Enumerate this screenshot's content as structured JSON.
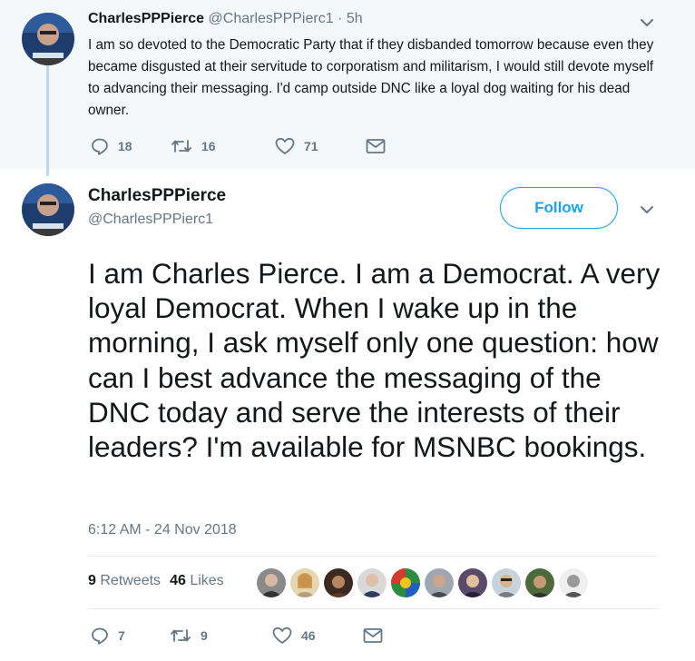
{
  "parent_tweet": {
    "name": "CharlesPPPierce",
    "handle": "@CharlesPPPierc1",
    "separator": "·",
    "time": "5h",
    "text": "I am so devoted to the Democratic Party that if they disbanded tomorrow because even they became disgusted at their servitude to corporatism and militarism, I would still devote myself to advancing their messaging. I'd camp outside DNC like a loyal dog waiting for his dead owner.",
    "replies": "18",
    "retweets": "16",
    "likes": "71"
  },
  "main_tweet": {
    "name": "CharlesPPPierce",
    "handle": "@CharlesPPPierc1",
    "follow_label": "Follow",
    "text": "I am Charles Pierce. I am a Democrat. A very loyal Democrat. When I wake up in the morning, I ask myself only one question: how can I best advance the messaging of the DNC today and serve the interests of their leaders? I'm available for MSNBC bookings.",
    "timestamp": "6:12 AM - 24 Nov 2018",
    "retweet_count": "9",
    "retweet_label": "Retweets",
    "like_count": "46",
    "like_label": "Likes",
    "replies": "7",
    "retweets": "9",
    "likes": "46"
  },
  "icons": {
    "reply": "reply-icon",
    "retweet": "retweet-icon",
    "like": "heart-icon",
    "dm": "envelope-icon",
    "caret": "chevron-down-icon"
  },
  "colors": {
    "accent": "#1da1f2",
    "muted": "#657786",
    "text": "#14171a",
    "parent_background": "#f5f8fa",
    "thread_line": "#b8dcf5",
    "divider": "#e6ecf0"
  },
  "likers": [
    "liker-1",
    "liker-2",
    "liker-3",
    "liker-4",
    "liker-5",
    "liker-6",
    "liker-7",
    "liker-8",
    "liker-9",
    "liker-10"
  ]
}
